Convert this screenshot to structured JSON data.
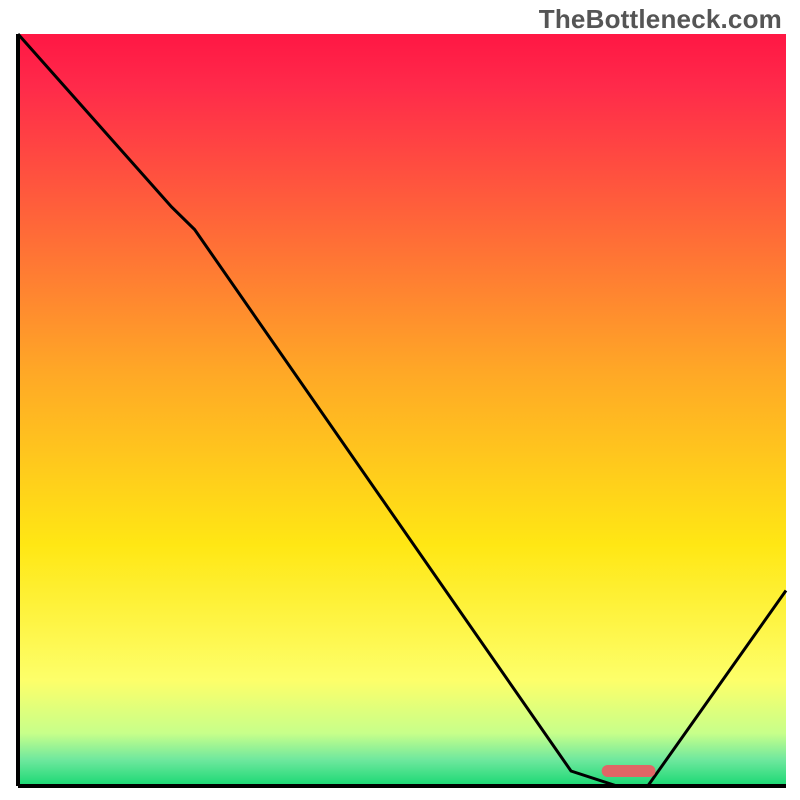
{
  "watermark": "TheBottleneck.com",
  "chart_data": {
    "type": "line",
    "title": "",
    "xlabel": "",
    "ylabel": "",
    "xlim": [
      0,
      100
    ],
    "ylim": [
      0,
      100
    ],
    "series": [
      {
        "name": "bottleneck-curve",
        "x": [
          0,
          20,
          23,
          72,
          78,
          82,
          100
        ],
        "y": [
          100,
          77,
          74,
          2,
          0,
          0,
          26
        ]
      }
    ],
    "marker": {
      "name": "optimal-range",
      "x_start": 76,
      "x_end": 83,
      "y": 2,
      "color": "#e06666"
    },
    "gradient_stops": [
      {
        "offset": 0.0,
        "color": "#ff1744"
      },
      {
        "offset": 0.07,
        "color": "#ff2a4a"
      },
      {
        "offset": 0.45,
        "color": "#ffa826"
      },
      {
        "offset": 0.68,
        "color": "#ffe714"
      },
      {
        "offset": 0.86,
        "color": "#fdff6a"
      },
      {
        "offset": 0.93,
        "color": "#c7ff8a"
      },
      {
        "offset": 0.965,
        "color": "#6fe89e"
      },
      {
        "offset": 1.0,
        "color": "#19d873"
      }
    ]
  }
}
